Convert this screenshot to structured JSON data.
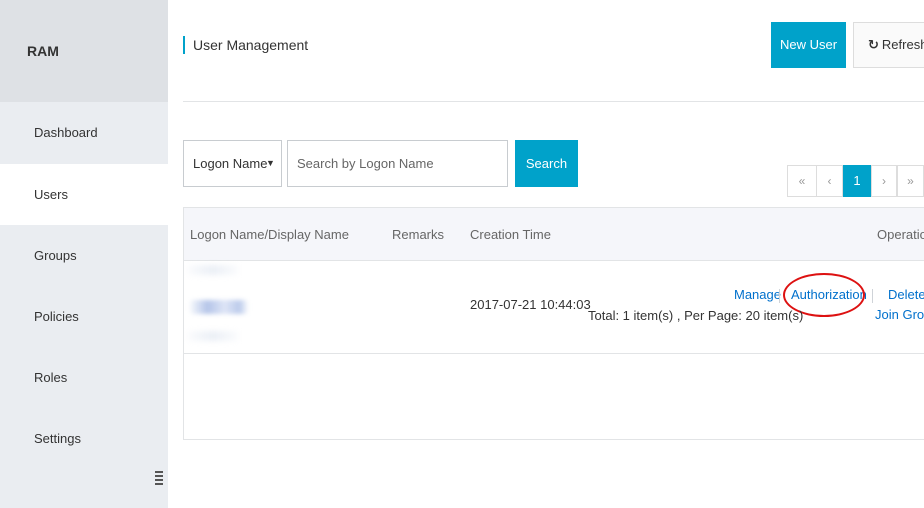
{
  "sidebar": {
    "title": "RAM",
    "items": [
      {
        "label": "Dashboard"
      },
      {
        "label": "Users",
        "active": true
      },
      {
        "label": "Groups"
      },
      {
        "label": "Policies"
      },
      {
        "label": "Roles"
      },
      {
        "label": "Settings"
      }
    ],
    "collapse_icon": "collapse-handle-icon"
  },
  "header": {
    "title": "User Management",
    "new_user_label": "New User",
    "refresh_label": "Refresh",
    "refresh_icon": "↻"
  },
  "filter": {
    "select_value": "Logon Name",
    "caret": "▼",
    "search_placeholder": "Search by Logon Name",
    "search_button": "Search"
  },
  "table": {
    "columns": {
      "name": "Logon Name/Display Name",
      "remarks": "Remarks",
      "creation": "Creation Time",
      "operation": "Operation"
    },
    "rows": [
      {
        "creation_time": "2017-07-21 10:44:03",
        "ops": {
          "manage": "Manage",
          "authorization": "Authorization",
          "delete": "Delete",
          "join_group": "Join Group"
        }
      }
    ]
  },
  "pagination": {
    "summary": "Total: 1 item(s) ,  Per Page: 20 item(s)",
    "first": "«",
    "prev": "‹",
    "current": "1",
    "next": "›",
    "last": "»"
  },
  "colors": {
    "accent": "#00a2ca",
    "link": "#0070cc",
    "highlight": "#dd1111"
  }
}
